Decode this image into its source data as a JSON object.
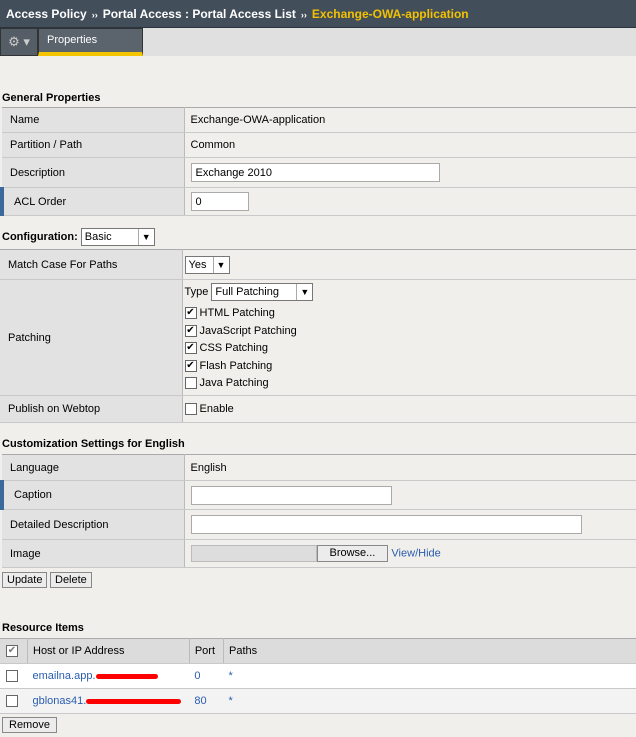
{
  "breadcrumb": {
    "items": [
      "Access Policy",
      "Portal Access : Portal Access List"
    ],
    "current": "Exchange-OWA-application",
    "sep": "››"
  },
  "tabs": {
    "gear": "⚙ ▾",
    "properties": "Properties"
  },
  "general": {
    "title": "General Properties",
    "name_label": "Name",
    "name_value": "Exchange-OWA-application",
    "partition_label": "Partition / Path",
    "partition_value": "Common",
    "description_label": "Description",
    "description_value": "Exchange 2010",
    "acl_label": "ACL Order",
    "acl_value": "0"
  },
  "configuration": {
    "label": "Configuration:",
    "value": "Basic",
    "match_case_label": "Match Case For Paths",
    "match_case_value": "Yes",
    "patching_label": "Patching",
    "type_label": "Type",
    "type_value": "Full Patching",
    "patch_options": [
      {
        "label": "HTML Patching",
        "checked": true
      },
      {
        "label": "JavaScript Patching",
        "checked": true
      },
      {
        "label": "CSS Patching",
        "checked": true
      },
      {
        "label": "Flash Patching",
        "checked": true
      },
      {
        "label": "Java Patching",
        "checked": false
      }
    ],
    "publish_label": "Publish on Webtop",
    "publish_option": "Enable"
  },
  "customization": {
    "title": "Customization Settings for English",
    "language_label": "Language",
    "language_value": "English",
    "caption_label": "Caption",
    "caption_value": "",
    "detailed_label": "Detailed Description",
    "detailed_value": "",
    "image_label": "Image",
    "browse": "Browse...",
    "view_hide": "View/Hide"
  },
  "actions": {
    "update": "Update",
    "delete": "Delete",
    "remove": "Remove"
  },
  "resources": {
    "title": "Resource Items",
    "columns": [
      "Host or IP Address",
      "Port",
      "Paths"
    ],
    "rows": [
      {
        "host": "emailna.app.",
        "port": "0",
        "paths": "*"
      },
      {
        "host": "gblonas41.",
        "port": "80",
        "paths": "*"
      }
    ]
  },
  "colors": {
    "accent": "#f5c400",
    "header": "#434e5b",
    "link": "#2a5db0"
  }
}
